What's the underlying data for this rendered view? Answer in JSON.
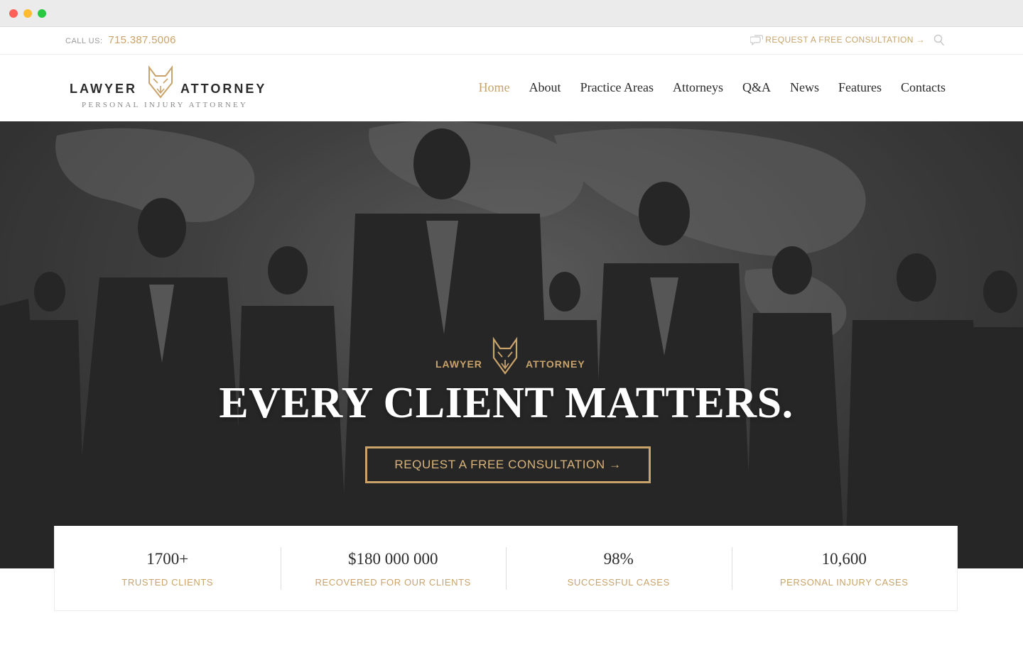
{
  "window": {
    "controls": [
      "close",
      "minimize",
      "zoom"
    ]
  },
  "topbar": {
    "call_label": "CALL US:",
    "phone": "715.387.5006",
    "consult_link": "REQUEST A FREE CONSULTATION →",
    "icons": [
      "chat-icon",
      "search-icon"
    ]
  },
  "header": {
    "logo_left": "LAWYER",
    "logo_right": "ATTORNEY",
    "tagline": "PERSONAL INJURY ATTORNEY",
    "nav": [
      {
        "label": "Home",
        "active": true
      },
      {
        "label": "About"
      },
      {
        "label": "Practice Areas"
      },
      {
        "label": "Attorneys"
      },
      {
        "label": "Q&A"
      },
      {
        "label": "News"
      },
      {
        "label": "Features"
      },
      {
        "label": "Contacts"
      }
    ]
  },
  "hero": {
    "brand_left": "LAWYER",
    "brand_right": "ATTORNEY",
    "title": "EVERY CLIENT MATTERS.",
    "button": "REQUEST A FREE CONSULTATION →"
  },
  "stats": [
    {
      "value": "1700+",
      "label": "TRUSTED CLIENTS"
    },
    {
      "value": "$180 000 000",
      "label": "RECOVERED FOR OUR CLIENTS"
    },
    {
      "value": "98%",
      "label": "SUCCESSFUL CASES"
    },
    {
      "value": "10,600",
      "label": "PERSONAL INJURY CASES"
    }
  ],
  "colors": {
    "accent": "#c9a36a",
    "text": "#2b2b2b",
    "muted": "#9a9a9a"
  }
}
